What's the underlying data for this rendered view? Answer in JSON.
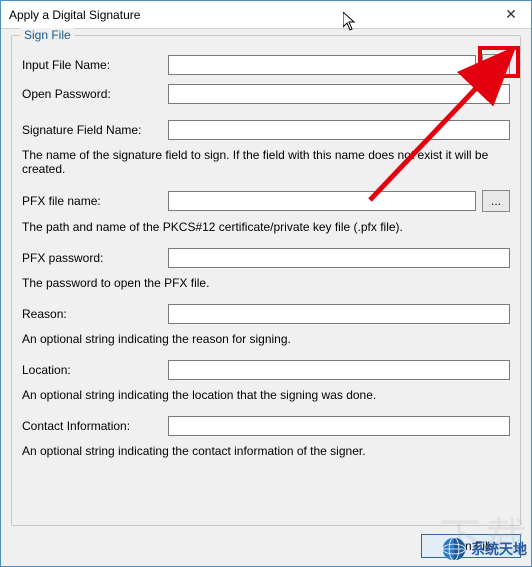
{
  "window": {
    "title": "Apply a Digital Signature",
    "close": "✕"
  },
  "group": {
    "label": "Sign File"
  },
  "fields": {
    "input_file": {
      "label": "Input File Name:",
      "value": "",
      "browse": "..."
    },
    "open_password": {
      "label": "Open Password:",
      "value": ""
    },
    "sig_field_name": {
      "label": "Signature Field Name:",
      "value": "",
      "desc": "The name of the signature field to sign. If the field with this name does not exist it will be created."
    },
    "pfx_file": {
      "label": "PFX file name:",
      "value": "",
      "browse": "...",
      "desc": "The path and name of the PKCS#12 certificate/private key file (.pfx file)."
    },
    "pfx_password": {
      "label": "PFX password:",
      "value": "",
      "desc": "The password to open the PFX file."
    },
    "reason": {
      "label": "Reason:",
      "value": "",
      "desc": "An optional string indicating the reason for signing."
    },
    "location": {
      "label": "Location:",
      "value": "",
      "desc": "An optional string indicating the location that the signing was done."
    },
    "contact": {
      "label": "Contact Information:",
      "value": "",
      "desc": "An optional string indicating the contact information of the signer."
    }
  },
  "buttons": {
    "sign": "Sign File"
  },
  "watermark": {
    "text": "系统天地",
    "bg": "下载"
  }
}
